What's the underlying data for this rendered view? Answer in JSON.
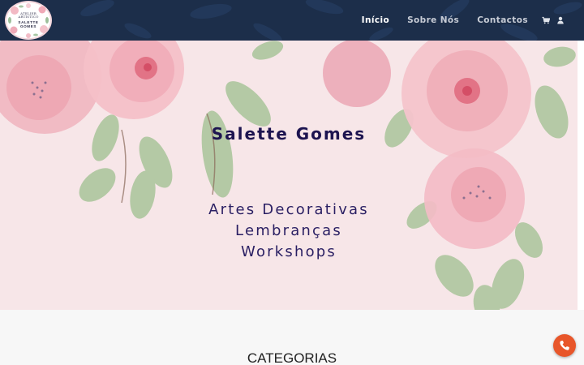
{
  "colors": {
    "header_bg": "#1c2e4a",
    "hero_bg": "#f7e6e8",
    "title_color": "#1d1450",
    "fab_color": "#e8562a"
  },
  "logo": {
    "line1": "ATELIER",
    "line2": "ARTÍSTICO",
    "name": "SALETTE",
    "surname": "GOMES"
  },
  "nav": {
    "items": [
      {
        "label": "Início",
        "active": true
      },
      {
        "label": "Sobre Nós",
        "active": false
      },
      {
        "label": "Contactos",
        "active": false
      }
    ],
    "icons": [
      "shopping-cart-icon",
      "user-icon"
    ]
  },
  "hero": {
    "title": "Salette Gomes",
    "lines": [
      "Artes Decorativas",
      "Lembranças",
      "Workshops"
    ]
  },
  "section": {
    "title": "CATEGORIAS"
  },
  "fab": {
    "icon": "phone-icon"
  }
}
